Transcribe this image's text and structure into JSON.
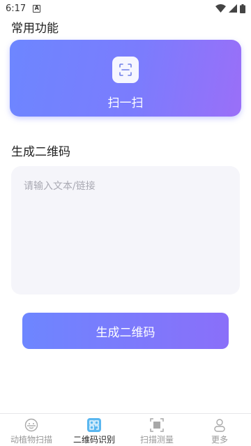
{
  "status_bar": {
    "time": "6:17",
    "notification_badge": "A"
  },
  "sections": {
    "common_functions": "常用功能",
    "generate_qr": "生成二维码"
  },
  "scan_card": {
    "label": "扫一扫"
  },
  "input": {
    "placeholder": "请输入文本/链接",
    "value": ""
  },
  "generate_button": {
    "label": "生成二维码"
  },
  "nav": {
    "items": [
      {
        "label": "动植物扫描",
        "icon": "face-scan-icon",
        "active": false
      },
      {
        "label": "二维码识别",
        "icon": "qr-recognize-icon",
        "active": true
      },
      {
        "label": "扫描测量",
        "icon": "measure-scan-icon",
        "active": false
      },
      {
        "label": "更多",
        "icon": "person-icon",
        "active": false
      }
    ]
  },
  "colors": {
    "accent_start": "#6d86ff",
    "accent_end": "#9a6ff8",
    "active_nav_icon": "#5ab7f0"
  }
}
